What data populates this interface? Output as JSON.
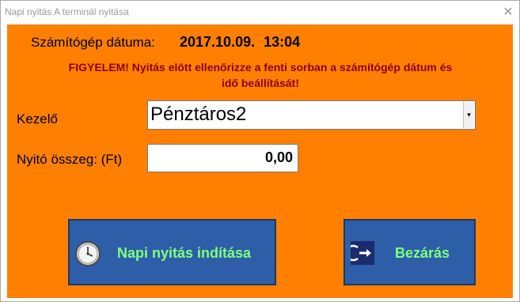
{
  "window": {
    "title": "Napi nyitás A terminál nyitása",
    "close_glyph": "✕"
  },
  "date": {
    "label": "Számítógép dátuma:",
    "value": "2017.10.09. 13:04"
  },
  "warning": {
    "line1": "FIGYELEM! Nyitás elött ellenőrizze a fenti sorban a számítógép dátum és",
    "line2": "idő beállítását!",
    "color": "#8b0000"
  },
  "operator": {
    "label": "Kezelő",
    "selected": "Pénztáros2",
    "dropdown_glyph": "▾"
  },
  "amount": {
    "label": "Nyitó összeg: (Ft)",
    "value": "0,00"
  },
  "buttons": {
    "open_label": "Napi nyitás indítása",
    "open_icon": "clock-icon",
    "close_label": "Bezárás",
    "close_icon": "exit-icon",
    "bg_color": "#2e5ea8",
    "text_color": "#7fff7f"
  },
  "colors": {
    "panel_bg": "#ff8000"
  }
}
